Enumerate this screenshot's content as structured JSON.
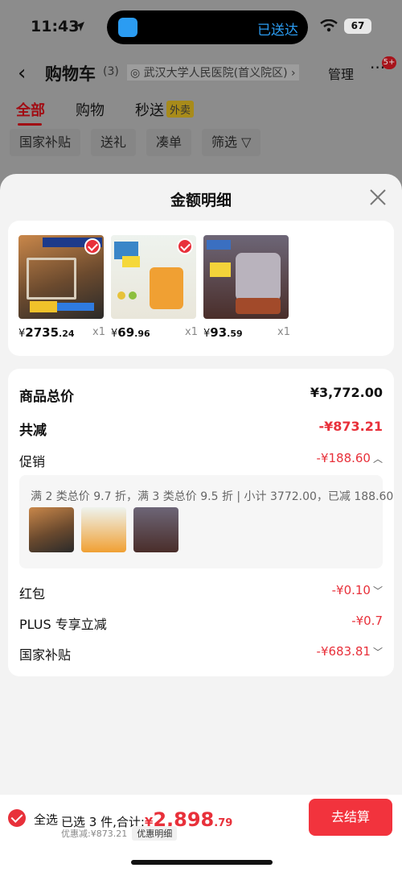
{
  "status_bar": {
    "time": "11:43",
    "island_text": "已送达",
    "battery": "67"
  },
  "nav": {
    "title": "购物车",
    "count": "(3)",
    "address": "◎ 武汉大学人民医院(首义院区) ›",
    "manage": "管理",
    "more": "···",
    "badge": "5+"
  },
  "tabs": [
    {
      "label": "全部",
      "active": true
    },
    {
      "label": "购物"
    },
    {
      "label": "秒送",
      "tag": "外卖"
    }
  ],
  "chips": [
    "国家补贴",
    "送礼",
    "凑单",
    "筛选 ▽"
  ],
  "sheet": {
    "title": "金额明细",
    "products": [
      {
        "yen": "¥",
        "int": "2735",
        "dec": ".24",
        "qty": "x1",
        "color": "#8a5a2c"
      },
      {
        "yen": "¥",
        "int": "69",
        "dec": ".96",
        "qty": "x1",
        "color": "#e9a23a"
      },
      {
        "yen": "¥",
        "int": "93",
        "dec": ".59",
        "qty": "x1",
        "color": "#7a6a7a"
      }
    ],
    "detail": {
      "subtotal_label": "商品总价",
      "subtotal_value": "¥3,772.00",
      "reduce_label": "共减",
      "reduce_value": "-¥873.21",
      "promo_label": "促销",
      "promo_value": "-¥188.60",
      "promo_text": "满 2 类总价 9.7 折，满 3 类总价 9.5 折 | 小计 3772.00，已减 188.60",
      "red_packet_label": "红包",
      "red_packet_value": "-¥0.10",
      "plus_label": "PLUS 专享立减",
      "plus_value": "-¥0.7",
      "subsidy_label": "国家补贴",
      "subsidy_value": "-¥683.81"
    }
  },
  "bottom": {
    "select_all": "全选",
    "total_label": "已选 3 件,合计:",
    "total_yen": "¥",
    "total_int": "2,898",
    "total_dec": ".79",
    "discount_text": "优惠减:¥873.21",
    "discount_link": "优惠明细",
    "checkout": "去结算"
  },
  "colors": {
    "accent": "#e8303a",
    "checkout": "#f2333d"
  }
}
